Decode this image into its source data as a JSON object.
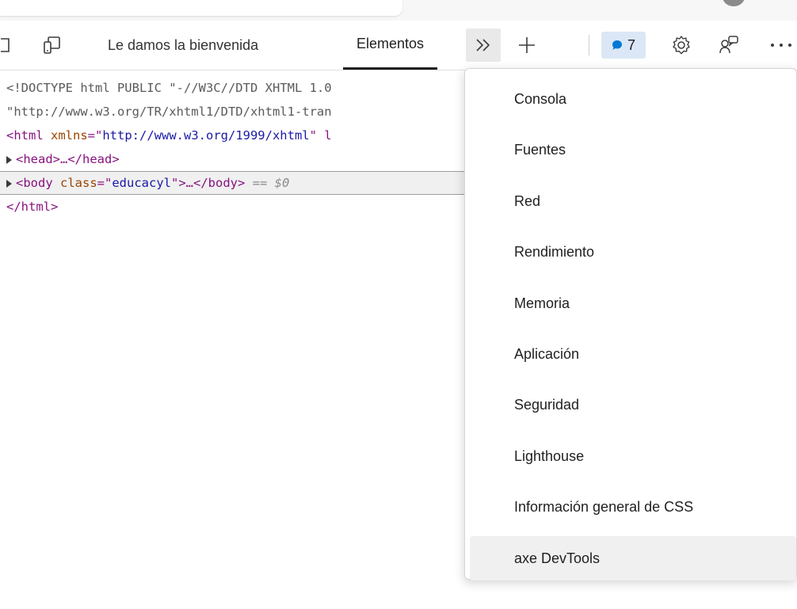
{
  "toolbar": {
    "tabs": [
      {
        "label": "Le damos la bienvenida"
      },
      {
        "label": "Elementos",
        "active": true
      }
    ],
    "overflow_icon": "chevrons-right-icon",
    "new_tab_icon": "plus-icon",
    "issues_count": "7",
    "colors": {
      "accent": "#0078d4",
      "badge_bg": "#dbe7f6"
    }
  },
  "dom": {
    "lines": [
      {
        "parts": [
          {
            "text": "<!DOCTYPE html PUBLIC \"-//W3C//DTD XHTML 1.0",
            "cls": "dt"
          }
        ]
      },
      {
        "parts": [
          {
            "text": "\"http://www.w3.org/TR/xhtml1/DTD/xhtml1-tran",
            "cls": "dt"
          }
        ]
      },
      {
        "parts": [
          {
            "text": "<html ",
            "cls": "tag"
          },
          {
            "text": "xmlns",
            "cls": "attr"
          },
          {
            "text": "=\"",
            "cls": "tag"
          },
          {
            "text": "http://www.w3.org/1999/xhtml",
            "cls": "val"
          },
          {
            "text": "\" l",
            "cls": "tag"
          }
        ]
      },
      {
        "expand": true,
        "parts": [
          {
            "text": "<head>…</head>",
            "cls": "tag"
          }
        ]
      },
      {
        "expand": true,
        "selected": true,
        "parts": [
          {
            "text": "<body ",
            "cls": "tag"
          },
          {
            "text": "class",
            "cls": "attr"
          },
          {
            "text": "=\"",
            "cls": "tag"
          },
          {
            "text": "educacyl",
            "cls": "val"
          },
          {
            "text": "\">…</body>",
            "cls": "tag"
          },
          {
            "text": " == $0",
            "cls": "eq0"
          }
        ]
      },
      {
        "parts": [
          {
            "text": "</html>",
            "cls": "tag"
          }
        ]
      }
    ]
  },
  "menu": {
    "items": [
      {
        "label": "Consola"
      },
      {
        "label": "Fuentes"
      },
      {
        "label": "Red"
      },
      {
        "label": "Rendimiento"
      },
      {
        "label": "Memoria"
      },
      {
        "label": "Aplicación"
      },
      {
        "label": "Seguridad"
      },
      {
        "label": "Lighthouse"
      },
      {
        "label": "Información general de CSS"
      },
      {
        "label": "axe DevTools",
        "hover": true
      }
    ]
  }
}
